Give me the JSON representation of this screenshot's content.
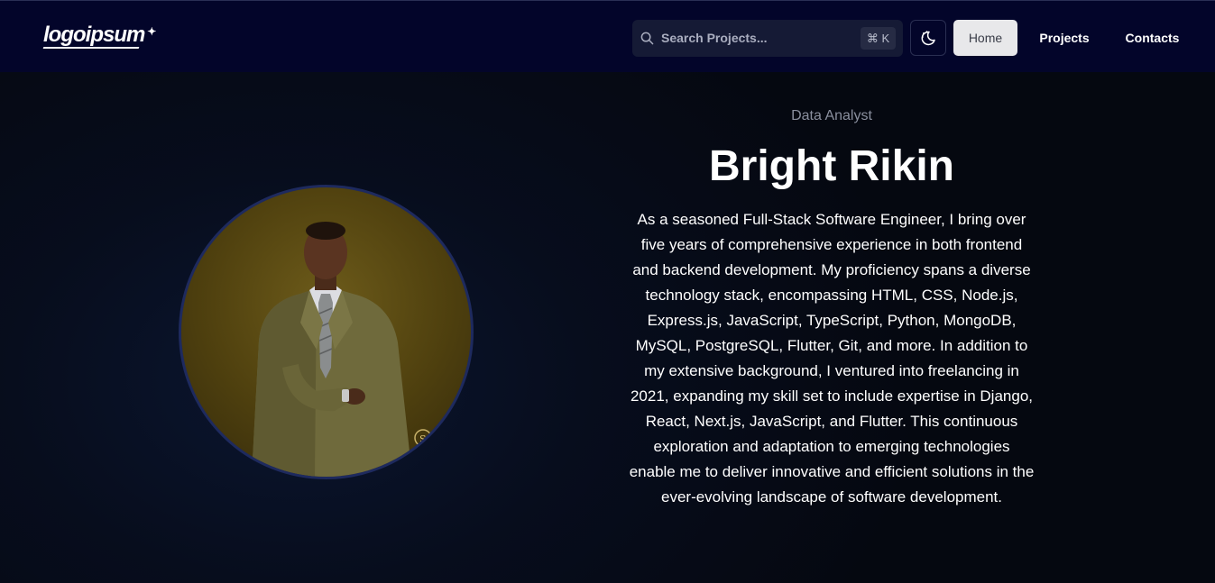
{
  "header": {
    "logo_text": "logoipsum",
    "search": {
      "placeholder": "Search Projects...",
      "shortcut": "⌘ K"
    },
    "theme_toggle_icon": "moon-stars-icon",
    "nav": [
      {
        "label": "Home",
        "active": true
      },
      {
        "label": "Projects",
        "active": false
      },
      {
        "label": "Contacts",
        "active": false
      }
    ]
  },
  "profile": {
    "role": "Data Analyst",
    "name": "Bright Rikin",
    "bio": "As a seasoned Full-Stack Software Engineer, I bring over five years of comprehensive experience in both frontend and backend development. My proficiency spans a diverse technology stack, encompassing HTML, CSS, Node.js, Express.js, JavaScript, TypeScript, Python, MongoDB, MySQL, PostgreSQL, Flutter, Git, and more. In addition to my extensive background, I ventured into freelancing in 2021, expanding my skill set to include expertise in Django, React, Next.js, JavaScript, and Flutter. This continuous exploration and adaptation to emerging technologies enable me to deliver innovative and efficient solutions in the ever-evolving landscape of software development."
  },
  "colors": {
    "navbar_bg": "#03052a",
    "page_bg": "#070d1d",
    "avatar_ring": "#1e2a5e",
    "active_nav_bg": "#e8e8ea"
  }
}
